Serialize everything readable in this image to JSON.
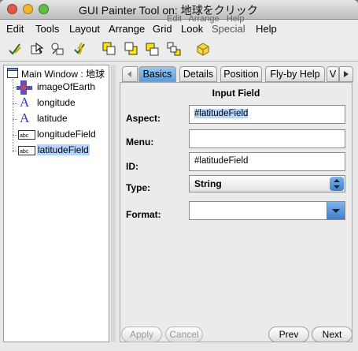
{
  "window": {
    "title": "GUI Painter Tool on: 地球をクリック"
  },
  "colors": {
    "selection": "#b5d5ff",
    "active_tab": "#5e9ad9",
    "close": "#e2574c",
    "minimize": "#f2b632",
    "zoom": "#5fbf43"
  },
  "menubar": {
    "items": [
      "Edit",
      "Tools",
      "Layout",
      "Arrange",
      "Grid",
      "Look",
      "Special",
      "Help"
    ],
    "behind_text": "Edit   Arrange   Help"
  },
  "toolbar": {
    "icons": [
      "check-pencil-icon",
      "select-tool-icon",
      "group-tool-icon",
      "lightning-check-icon",
      "align-front-icon",
      "align-back-icon",
      "align-left-icon",
      "distribute-icon",
      "install-cube-icon"
    ]
  },
  "tree": {
    "root": "Main Window : 地球",
    "items": [
      {
        "label": "imageOfEarth",
        "icon": "image-widget-icon"
      },
      {
        "label": "longitude",
        "icon": "label-widget-icon"
      },
      {
        "label": "latitude",
        "icon": "label-widget-icon"
      },
      {
        "label": "longitudeField",
        "icon": "input-field-icon"
      },
      {
        "label": "latitudeField",
        "icon": "input-field-icon",
        "selected": true
      }
    ]
  },
  "tabs": {
    "items": [
      "Basics",
      "Details",
      "Position",
      "Fly-by Help",
      "V"
    ],
    "active": "Basics"
  },
  "form": {
    "heading": "Input Field",
    "aspect_label": "Aspect:",
    "aspect_value": "#latitudeField",
    "menu_label": "Menu:",
    "menu_value": "",
    "id_label": "ID:",
    "id_value": "#latitudeField",
    "type_label": "Type:",
    "type_value": "String",
    "format_label": "Format:",
    "format_value": ""
  },
  "buttons": {
    "apply": "Apply",
    "cancel": "Cancel",
    "prev": "Prev",
    "next": "Next"
  }
}
